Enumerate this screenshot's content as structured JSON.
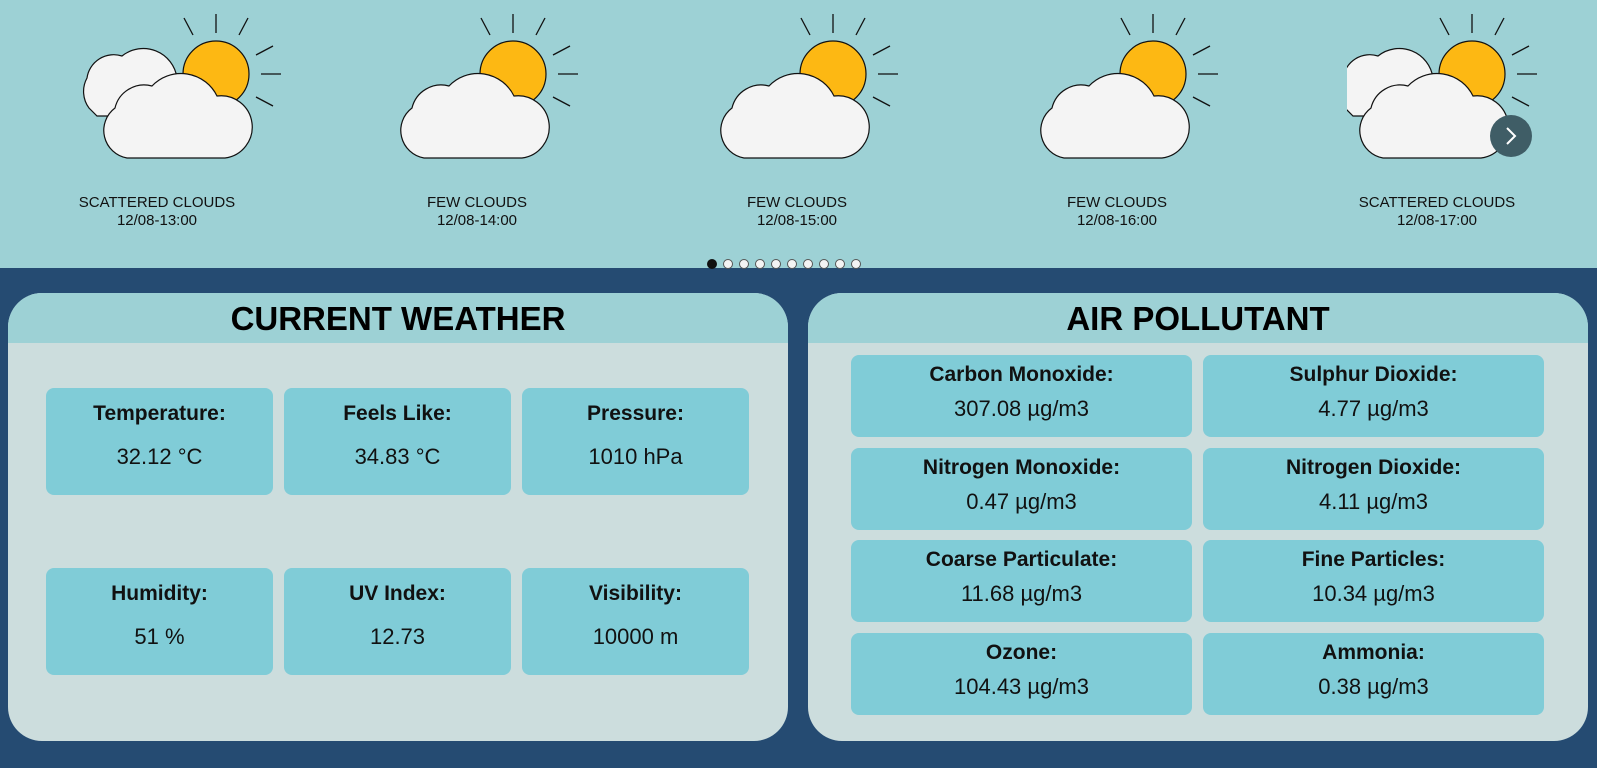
{
  "forecast": {
    "slides": [
      {
        "condition": "SCATTERED CLOUDS",
        "time": "12/08-13:00",
        "icon": "scattered-clouds-icon"
      },
      {
        "condition": "FEW CLOUDS",
        "time": "12/08-14:00",
        "icon": "few-clouds-icon"
      },
      {
        "condition": "FEW CLOUDS",
        "time": "12/08-15:00",
        "icon": "few-clouds-icon"
      },
      {
        "condition": "FEW CLOUDS",
        "time": "12/08-16:00",
        "icon": "few-clouds-icon"
      },
      {
        "condition": "SCATTERED CLOUDS",
        "time": "12/08-17:00",
        "icon": "scattered-clouds-icon"
      }
    ],
    "page_count": 10,
    "active_page": 1,
    "next_icon": "chevron-right-icon"
  },
  "current": {
    "title": "CURRENT WEATHER",
    "items": [
      {
        "label": "Temperature:",
        "value": "32.12 °C"
      },
      {
        "label": "Feels Like:",
        "value": "34.83 °C"
      },
      {
        "label": "Pressure:",
        "value": "1010 hPa"
      },
      {
        "label": "Humidity:",
        "value": "51 %"
      },
      {
        "label": "UV Index:",
        "value": "12.73"
      },
      {
        "label": "Visibility:",
        "value": "10000 m"
      }
    ]
  },
  "air": {
    "title": "AIR POLLUTANT",
    "items": [
      {
        "label": "Carbon Monoxide:",
        "value": "307.08 µg/m3"
      },
      {
        "label": "Sulphur Dioxide:",
        "value": "4.77 µg/m3"
      },
      {
        "label": "Nitrogen Monoxide:",
        "value": "0.47 µg/m3"
      },
      {
        "label": "Nitrogen Dioxide:",
        "value": "4.11 µg/m3"
      },
      {
        "label": "Coarse Particulate:",
        "value": "11.68 µg/m3"
      },
      {
        "label": "Fine Particles:",
        "value": "10.34 µg/m3"
      },
      {
        "label": "Ozone:",
        "value": "104.43 µg/m3"
      },
      {
        "label": "Ammonia:",
        "value": "0.38 µg/m3"
      }
    ]
  },
  "colors": {
    "page_bg": "#254b72",
    "header_bg": "#9dd1d5",
    "panel_bg": "#ccdddd",
    "card_bg": "#80ccd7",
    "sun": "#fdb813",
    "cloud": "#f4f4f4"
  }
}
